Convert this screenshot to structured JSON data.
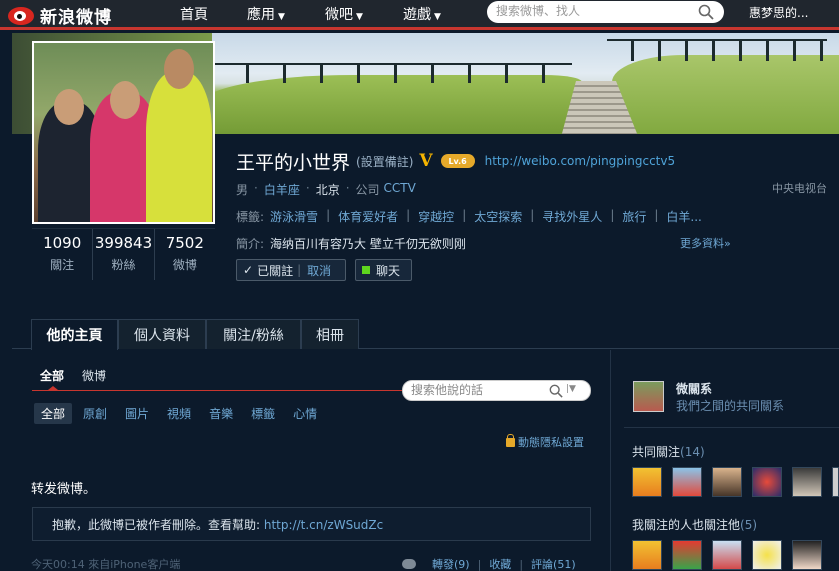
{
  "topnav": {
    "logo_text": "新浪微博",
    "items": [
      {
        "label": "首頁",
        "has_caret": false
      },
      {
        "label": "應用",
        "has_caret": true
      },
      {
        "label": "微吧",
        "has_caret": true
      },
      {
        "label": "遊戲",
        "has_caret": true
      }
    ],
    "search_placeholder": "搜索微博、找人",
    "user_name": "惠梦思的..."
  },
  "profile": {
    "name": "王平的小世界",
    "remark": "(設置備註)",
    "verified_badge": "V",
    "level_badge": "Lv.6",
    "home_url": "http://weibo.com/pingpingcctv5",
    "gender": "男",
    "zodiac": "白羊座",
    "city": "北京",
    "company_label": "公司",
    "company": "CCTV",
    "company_right": "中央电视台",
    "tags_label": "標籤:",
    "tags": [
      "游泳滑雪",
      "体育爱好者",
      "穿越控",
      "太空探索",
      "寻找外星人",
      "旅行",
      "白羊..."
    ],
    "intro_label": "簡介:",
    "intro": "海纳百川有容乃大 壁立千仞无欲则刚",
    "more_info": "更多資料»",
    "follow_button": {
      "label": "已關註",
      "cancel": "取消"
    },
    "chat_button": "聊天"
  },
  "stats": [
    {
      "num": "1090",
      "label": "關注"
    },
    {
      "num": "399843",
      "label": "粉絲"
    },
    {
      "num": "7502",
      "label": "微博"
    }
  ],
  "tabs": [
    "他的主頁",
    "個人資料",
    "關注/粉絲",
    "相冊"
  ],
  "feed": {
    "subtabs": [
      "全部",
      "微博"
    ],
    "search_placeholder": "搜索他說的話",
    "filters": [
      "全部",
      "原創",
      "圖片",
      "視頻",
      "音樂",
      "標籤",
      "心情"
    ],
    "privacy": "動態隱私設置",
    "post_text": "转发微博。",
    "deleted_msg": "抱歉，此微博已被作者刪除。查看幫助:",
    "deleted_link": "http://t.cn/zWSudZc",
    "post_meta": "今天00:14  來自iPhone客户端",
    "actions": [
      "轉發(9)",
      "收藏",
      "評論(51)"
    ]
  },
  "sidebar": {
    "relation_title": "微關系",
    "relation_sub": "我們之間的共同關系",
    "common_follow_label": "共同關注",
    "common_follow_count": "(14)",
    "also_follow_label": "我關注的人也關注他",
    "also_follow_count": "(5)"
  },
  "colors": {
    "accent_red": "#c8362f",
    "link_blue": "#6fa8d4",
    "bg": "#0c1a2b",
    "badge_gold": "#e6a92a"
  }
}
